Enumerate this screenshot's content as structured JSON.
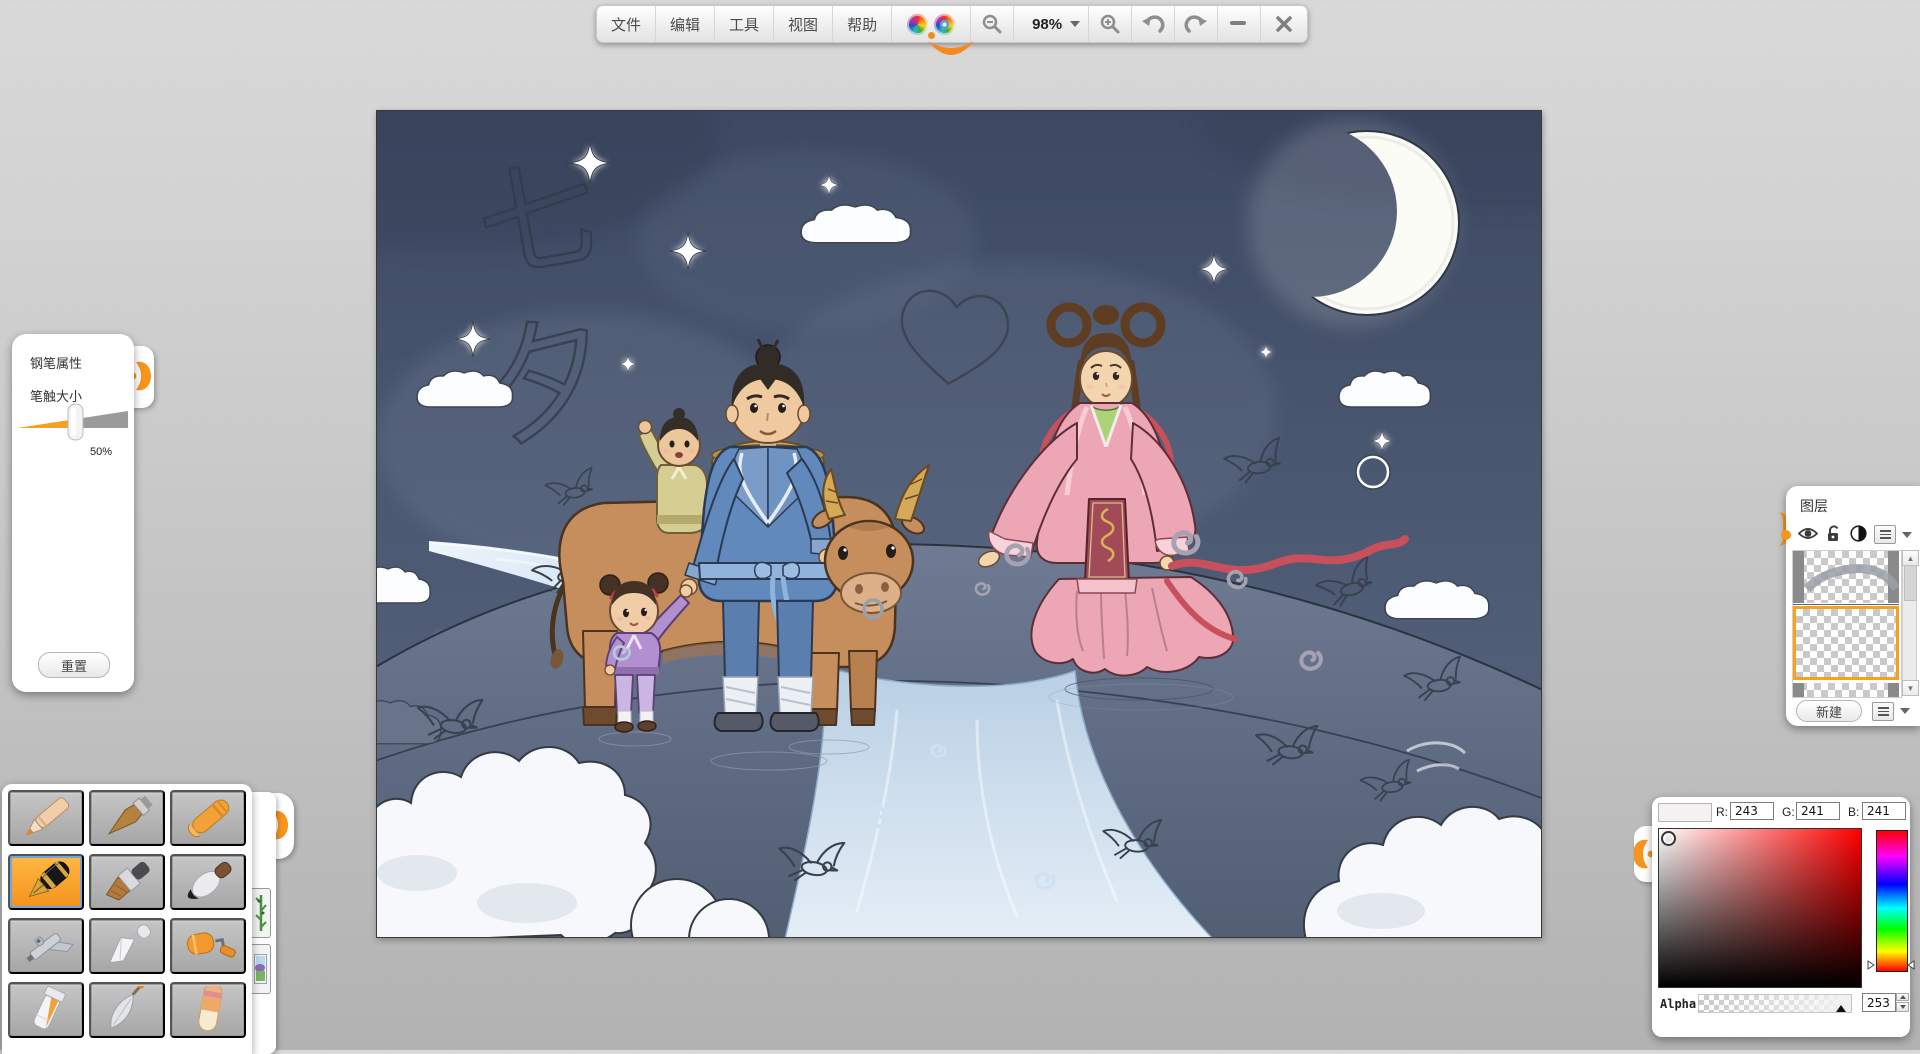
{
  "toolbar": {
    "menus": [
      "文件",
      "编辑",
      "工具",
      "视图",
      "帮助"
    ],
    "mascot_icon": "rainbow-mascot-face",
    "zoom_out_icon": "magnifier-minus-icon",
    "zoom_level": "98%",
    "zoom_in_icon": "magnifier-plus-icon",
    "undo_icon": "undo-arrow-icon",
    "redo_icon": "redo-arrow-icon",
    "minimize_icon": "minimize-dash-icon",
    "close_icon": "close-x-icon"
  },
  "pen_panel": {
    "title": "钢笔属性",
    "size_label": "笔触大小",
    "size_value": "50%",
    "reset_label": "重置",
    "slider_fill_color": "#f5a11d"
  },
  "tool_palette": {
    "selected_tool": "fountain-pen",
    "selected_bg_color": "#f3921d",
    "tools": [
      {
        "name": "colored-pencil"
      },
      {
        "name": "wood-stylus"
      },
      {
        "name": "crayon"
      },
      {
        "name": "fountain-pen",
        "selected": true
      },
      {
        "name": "flat-brush"
      },
      {
        "name": "ink-brush"
      },
      {
        "name": "airbrush"
      },
      {
        "name": "palette-knife"
      },
      {
        "name": "paint-roller"
      },
      {
        "name": "paint-bottle"
      },
      {
        "name": "leaf-blade"
      },
      {
        "name": "eraser"
      }
    ],
    "side_buttons": [
      {
        "name": "bamboo-decor"
      },
      {
        "name": "stamp-picture"
      }
    ]
  },
  "layers_panel": {
    "title": "图层",
    "header_icons": [
      "eye-icon",
      "open-lock-icon",
      "blend-circle-icon",
      "layer-menu-icon"
    ],
    "layers": [
      {
        "name": "sketch-layer",
        "selected": false
      },
      {
        "name": "paint-layer",
        "selected": true
      }
    ],
    "selected_border_color": "#f7a11c",
    "new_button": "新建"
  },
  "color_panel": {
    "swatch_color": "#f3f1f1",
    "r_label": "R:",
    "r_value": "243",
    "g_label": "G:",
    "g_value": "241",
    "b_label": "B:",
    "b_value": "241",
    "alpha_label": "Alpha",
    "alpha_value": "253",
    "hue_selected": "red"
  },
  "canvas": {
    "sketch_char_1": "七",
    "sketch_char_2": "夕",
    "theme": "qixi-cowherd-weaver-night-scene"
  },
  "accent_color": "#f7941d"
}
